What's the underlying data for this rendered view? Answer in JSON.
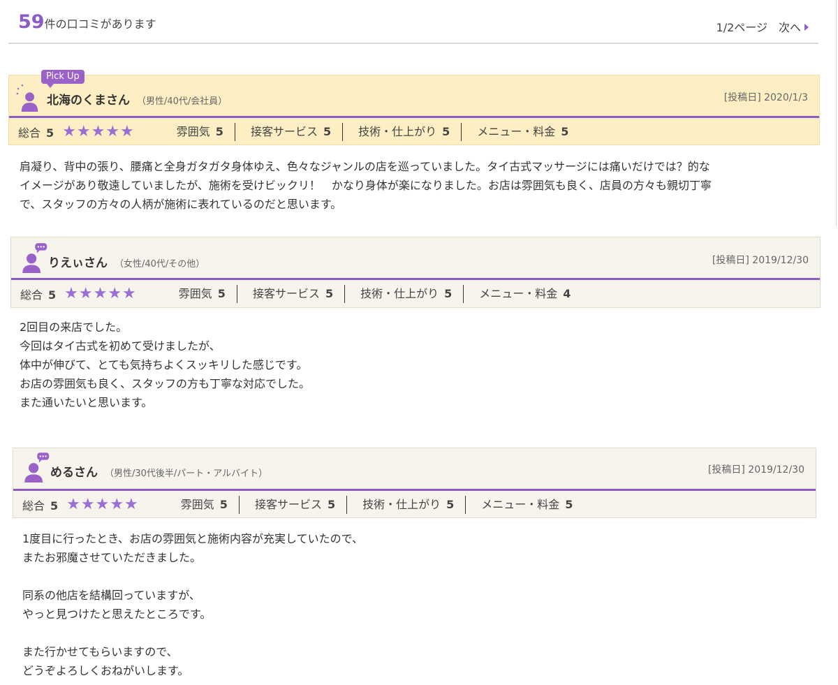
{
  "header": {
    "count": "59",
    "count_label": "件の口コミがあります",
    "page_indicator": "1/2ページ",
    "next_label": "次へ"
  },
  "colors": {
    "accent": "#8c5cc6",
    "pickup_bg": "#fdefc3",
    "header_bg": "#f6f4ed"
  },
  "score_labels": {
    "total": "総合",
    "atmosphere": "雰囲気",
    "service": "接客サービス",
    "skill": "技術・仕上がり",
    "price": "メニュー・料金"
  },
  "reviews": [
    {
      "badge": "Pick Up",
      "name": "北海のくまさん",
      "attrs": "（男性/40代/会社員）",
      "posted": "[投稿日] 2020/1/3",
      "total": "5",
      "stars": "★★★★★",
      "rating_stars": 5,
      "atmosphere": "5",
      "service": "5",
      "skill": "5",
      "price": "5",
      "body": [
        "肩凝り、背中の張り、腰痛と全身ガタガタ身体ゆえ、色々なジャンルの店を巡っていました。タイ古式マッサージには痛いだけでは？的な",
        "イメージがあり敬遠していましたが、施術を受けビックリ！　かなり身体が楽になりました。お店は雰囲気も良く、店員の方々も親切丁寧",
        "で、スタッフの方々の人柄が施術に表れているのだと思います。"
      ]
    },
    {
      "name": "りえぃさん",
      "attrs": "（女性/40代/その他）",
      "posted": "[投稿日] 2019/12/30",
      "total": "5",
      "stars": "★★★★★",
      "rating_stars": 5,
      "atmosphere": "5",
      "service": "5",
      "skill": "5",
      "price": "4",
      "body": [
        "2回目の来店でした。",
        "今回はタイ古式を初めて受けましたが、",
        "体中が伸びて、とても気持ちよくスッキリした感じです。",
        "お店の雰囲気も良く、スタッフの方も丁寧な対応でした。",
        "また通いたいと思います。"
      ]
    },
    {
      "name": "めるさん",
      "attrs": "（男性/30代後半/パート・アルバイト）",
      "posted": "[投稿日] 2019/12/30",
      "total": "5",
      "stars": "★★★★★",
      "rating_stars": 5,
      "atmosphere": "5",
      "service": "5",
      "skill": "5",
      "price": "5",
      "body": [
        "1度目に行ったとき、お店の雰囲気と施術内容が充実していたので、",
        "またお邪魔させていただきました。",
        "",
        "同系の他店を結構回っていますが、",
        "やっと見つけたと思えたところです。",
        "",
        "また行かせてもらいますので、",
        "どうぞよろしくおねがいします。"
      ]
    }
  ]
}
